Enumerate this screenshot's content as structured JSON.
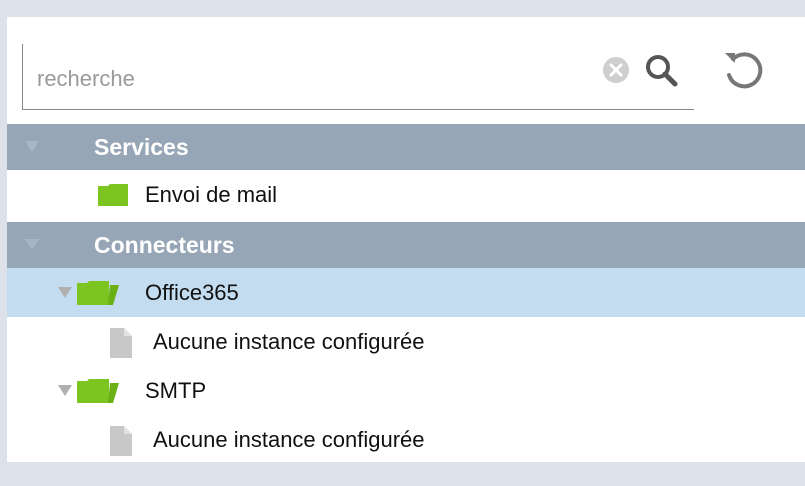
{
  "search": {
    "placeholder": "recherche",
    "value": ""
  },
  "icons": {
    "clear": "clear-circle-icon",
    "search": "magnifier-icon",
    "refresh": "refresh-icon",
    "folder": "folder-icon",
    "document": "document-icon",
    "expand_arrow": "triangle-down-icon"
  },
  "colors": {
    "section_header_bg": "#97a6b6",
    "selected_row_bg": "#c3dcf0",
    "folder_green": "#7cc41f",
    "document_gray": "#c8c8c8"
  },
  "tree": {
    "services": {
      "label": "Services",
      "items": [
        {
          "label": "Envoi de mail"
        }
      ]
    },
    "connecteurs": {
      "label": "Connecteurs",
      "items": [
        {
          "label": "Office365",
          "selected": true,
          "child": "Aucune instance configurée"
        },
        {
          "label": "SMTP",
          "selected": false,
          "child": "Aucune instance configurée"
        }
      ]
    }
  }
}
